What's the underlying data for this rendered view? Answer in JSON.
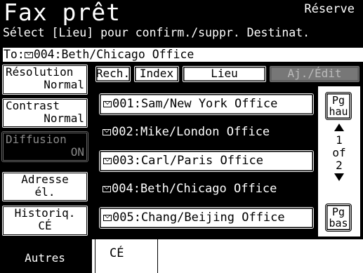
{
  "header": {
    "title": "Fax prêt",
    "status": "Réserve",
    "instruction": "Sélect [Lieu] pour confirm./suppr. Destinat.",
    "to_prefix": "To:",
    "to_value": "004:Beth/Chicago Office"
  },
  "left_menu": {
    "resolution": {
      "label": "Résolution",
      "value": "Normal"
    },
    "contrast": {
      "label": "Contrast",
      "value": "Normal"
    },
    "diffusion": {
      "label": "Diffusion",
      "value": "ON"
    },
    "address": {
      "line1": "Adresse",
      "line2": "él."
    },
    "history": {
      "line1": "Historiq.",
      "line2": "CÉ"
    },
    "other": "Autres"
  },
  "tabs": {
    "search": "Rech.",
    "index": "Index",
    "location": "Lieu",
    "add_edit": "Aj./Édit"
  },
  "entries": [
    {
      "text": "001:Sam/New York Office",
      "selected": false
    },
    {
      "text": "002:Mike/London Office",
      "selected": true
    },
    {
      "text": "003:Carl/Paris Office",
      "selected": false
    },
    {
      "text": "004:Beth/Chicago Office",
      "selected": true
    },
    {
      "text": "005:Chang/Beijing Office",
      "selected": false
    }
  ],
  "pager": {
    "up_line1": "Pg",
    "up_line2": "hau",
    "current": "1",
    "of": "of",
    "total": "2",
    "down_line1": "Pg",
    "down_line2": "bas"
  },
  "bottom_tab": "CÉ",
  "icons": {
    "entry": "envelope-icon",
    "up": "up-arrow-icon",
    "down": "down-arrow-icon"
  }
}
